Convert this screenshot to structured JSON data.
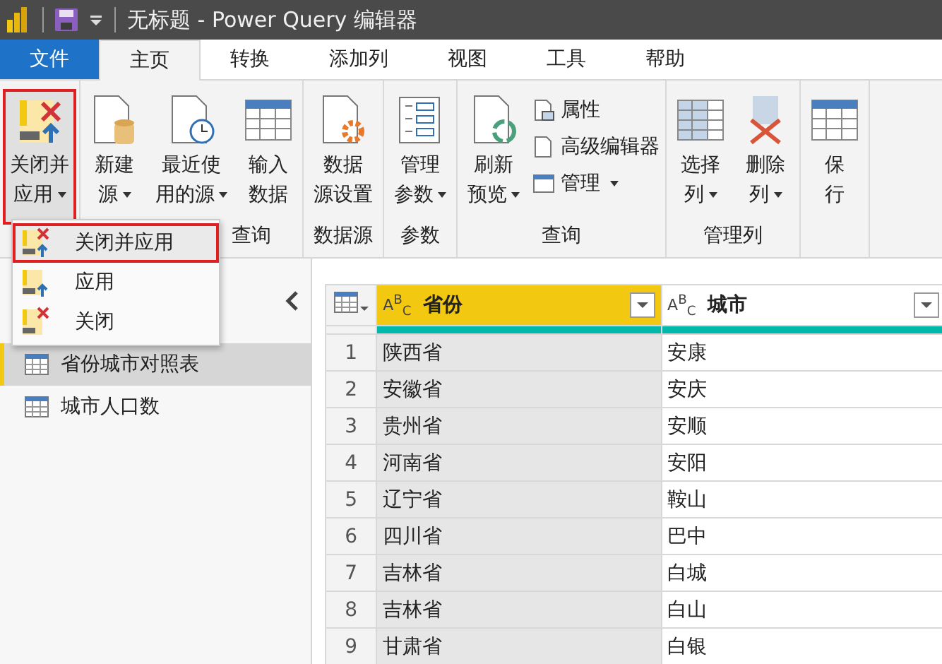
{
  "title_bar": {
    "title": "无标题 - Power Query 编辑器"
  },
  "tabs": [
    {
      "label": "文件",
      "kind": "file",
      "selected": false
    },
    {
      "label": "主页",
      "kind": "tab",
      "selected": true
    },
    {
      "label": "转换",
      "kind": "tab",
      "selected": false
    },
    {
      "label": "添加列",
      "kind": "tab",
      "selected": false
    },
    {
      "label": "视图",
      "kind": "tab",
      "selected": false
    },
    {
      "label": "工具",
      "kind": "tab",
      "selected": false
    },
    {
      "label": "帮助",
      "kind": "tab",
      "selected": false
    }
  ],
  "ribbon": {
    "groups": [
      {
        "buttons": [
          {
            "kind": "large",
            "lines": [
              "关闭并",
              "应用"
            ],
            "dropdown": true,
            "selected": true
          }
        ]
      },
      {
        "label": "查询",
        "label_partly_hidden": true,
        "buttons": [
          {
            "kind": "large",
            "lines": [
              "新建",
              "源"
            ],
            "dropdown": true,
            "selected": false
          },
          {
            "kind": "large",
            "lines": [
              "最近使",
              "用的源"
            ],
            "dropdown": true,
            "selected": false
          },
          {
            "kind": "large",
            "lines": [
              "输入",
              "数据"
            ],
            "dropdown": false,
            "selected": false
          }
        ]
      },
      {
        "label": "数据源",
        "buttons": [
          {
            "kind": "large",
            "lines": [
              "数据",
              "源设置"
            ],
            "dropdown": false,
            "selected": false
          }
        ]
      },
      {
        "label": "参数",
        "buttons": [
          {
            "kind": "large",
            "lines": [
              "管理",
              "参数"
            ],
            "dropdown": true,
            "selected": false
          }
        ]
      },
      {
        "label": "查询",
        "buttons": [
          {
            "kind": "large",
            "lines": [
              "刷新",
              "预览"
            ],
            "dropdown": true,
            "selected": false
          },
          {
            "kind": "stack",
            "items": [
              {
                "label": "属性",
                "dropdown": false
              },
              {
                "label": "高级编辑器",
                "dropdown": false
              },
              {
                "label": "管理",
                "dropdown": true
              }
            ]
          }
        ]
      },
      {
        "label": "管理列",
        "buttons": [
          {
            "kind": "large",
            "lines": [
              "选择",
              "列"
            ],
            "dropdown": true,
            "selected": false
          },
          {
            "kind": "large",
            "lines": [
              "删除",
              "列"
            ],
            "dropdown": true,
            "selected": false
          }
        ]
      },
      {
        "buttons": [
          {
            "kind": "large",
            "lines": [
              "保",
              "行"
            ],
            "dropdown": false,
            "selected": false
          }
        ]
      }
    ]
  },
  "menu": {
    "items": [
      {
        "label": "关闭并应用",
        "selected": true
      },
      {
        "label": "应用",
        "selected": false
      },
      {
        "label": "关闭",
        "selected": false
      }
    ]
  },
  "queries": [
    {
      "label": "省份城市对照表",
      "selected": true
    },
    {
      "label": "城市人口数",
      "selected": false
    }
  ],
  "table": {
    "columns": [
      {
        "kind": "corner"
      },
      {
        "type": "A$^{B}$$_{C}$",
        "name": "省份",
        "selected": true
      },
      {
        "type": "A$^{B}$$_{C}$",
        "name": "城市",
        "selected": false
      }
    ],
    "rows": [
      [
        "1",
        "陕西省",
        "安康"
      ],
      [
        "2",
        "安徽省",
        "安庆"
      ],
      [
        "3",
        "贵州省",
        "安顺"
      ],
      [
        "4",
        "河南省",
        "安阳"
      ],
      [
        "5",
        "辽宁省",
        "鞍山"
      ],
      [
        "6",
        "四川省",
        "巴中"
      ],
      [
        "7",
        "吉林省",
        "白城"
      ],
      [
        "8",
        "吉林省",
        "白山"
      ],
      [
        "9",
        "甘肃省",
        "白银"
      ]
    ]
  }
}
